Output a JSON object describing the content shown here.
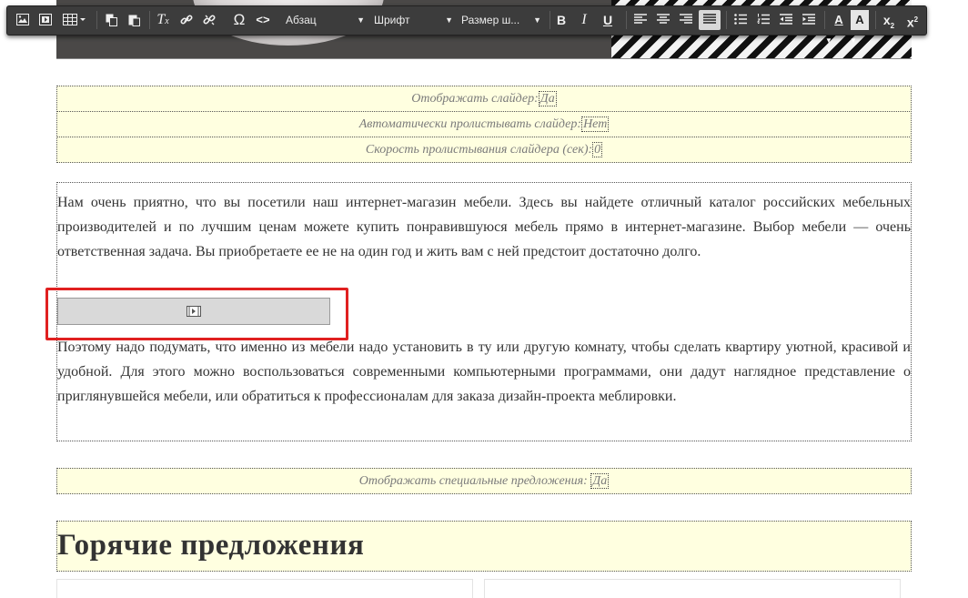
{
  "toolbar": {
    "format_label": "Абзац",
    "font_label": "Шрифт",
    "size_label": "Размер ш...",
    "bold": "B",
    "italic": "I",
    "underline": "U",
    "special_char": "Ω",
    "source": "<>",
    "text_color_letter": "A",
    "bg_color_letter": "A",
    "subscript": "x",
    "subscript_mark": "2",
    "superscript": "x",
    "superscript_mark": "2"
  },
  "settings": {
    "show_slider": {
      "label": "Отображать слайдер:",
      "value": "Да"
    },
    "autoplay_slider": {
      "label": "Автоматически пролистывать слайдер:",
      "value": "Нет"
    },
    "slider_speed": {
      "label": "Скорость пролистывания слайдера (сек):",
      "value": "0"
    },
    "show_special": {
      "label": "Отображать специальные предложения:",
      "value": "Да"
    }
  },
  "content": {
    "paragraph1": "Нам очень приятно, что вы посетили наш интернет-магазин мебели. Здесь вы найдете отличный каталог российских мебельных производителей и по лучшим ценам можете купить понравившуюся мебель прямо в интернет-магазине. Выбор мебели — очень ответственная задача. Вы приобретаете ее не на один год и жить вам с ней предстоит достаточно долго.",
    "paragraph2": "Поэтому надо подумать, что именно из мебели надо установить в ту или другую комнату, чтобы сделать квартиру уютной, красивой и удобной. Для этого можно воспользоваться современными компьютерными программами, они дадут наглядное представление о приглянувшейся мебели, или обратиться к профессионалам для заказа дизайн-проекта меблировки.",
    "hot_offers_title": "Горячие предложения"
  },
  "icons": [
    "image-icon",
    "flash-icon",
    "table-icon",
    "copy-icon",
    "paste-icon",
    "clear-format-icon",
    "link-icon",
    "unlink-icon",
    "align-left-icon",
    "align-center-icon",
    "align-right-icon",
    "align-justify-icon",
    "bullet-list-icon",
    "numbered-list-icon",
    "outdent-icon",
    "indent-icon",
    "video-embed-icon"
  ],
  "colors": {
    "toolbar_bg": "#3c3c3c",
    "setting_bg": "#ffffe0",
    "highlight_frame": "#e02020"
  }
}
